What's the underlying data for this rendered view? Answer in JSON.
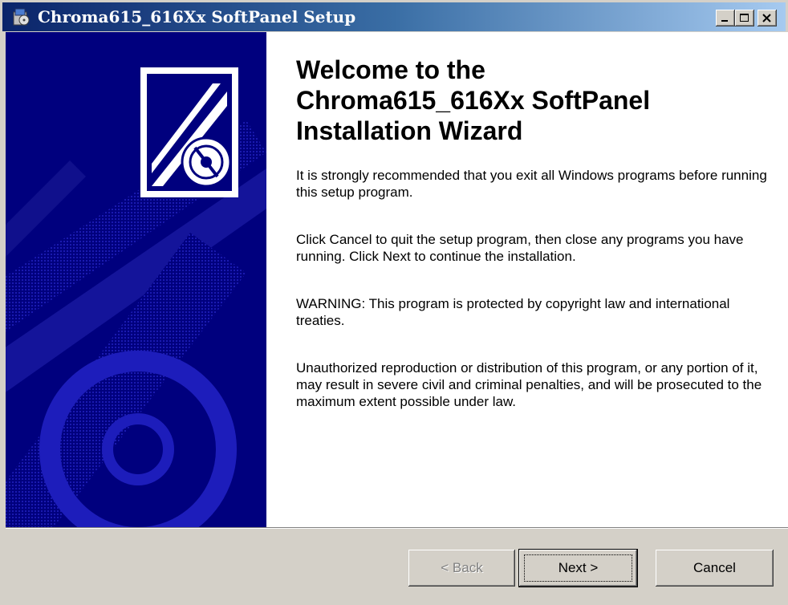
{
  "window": {
    "title": "Chroma615_616Xx SoftPanel Setup",
    "icon": "setup-icon"
  },
  "content": {
    "heading_lines": [
      "Welcome to the",
      "Chroma615_616Xx SoftPanel",
      "Installation Wizard"
    ],
    "paragraphs": [
      "It is strongly recommended that you exit all Windows programs before running this setup program.",
      "Click Cancel to quit the setup program, then close any programs you have running.  Click Next to continue the installation.",
      "WARNING: This program is protected by copyright law and international treaties.",
      "Unauthorized reproduction or distribution of this program, or any portion of it, may result in severe civil and criminal penalties, and will be prosecuted to the maximum extent possible under law."
    ]
  },
  "buttons": {
    "back": "< Back",
    "next": "Next >",
    "cancel": "Cancel"
  },
  "colors": {
    "banner": "#00007e",
    "title_start": "#0a246a",
    "title_end": "#a6caf0"
  }
}
